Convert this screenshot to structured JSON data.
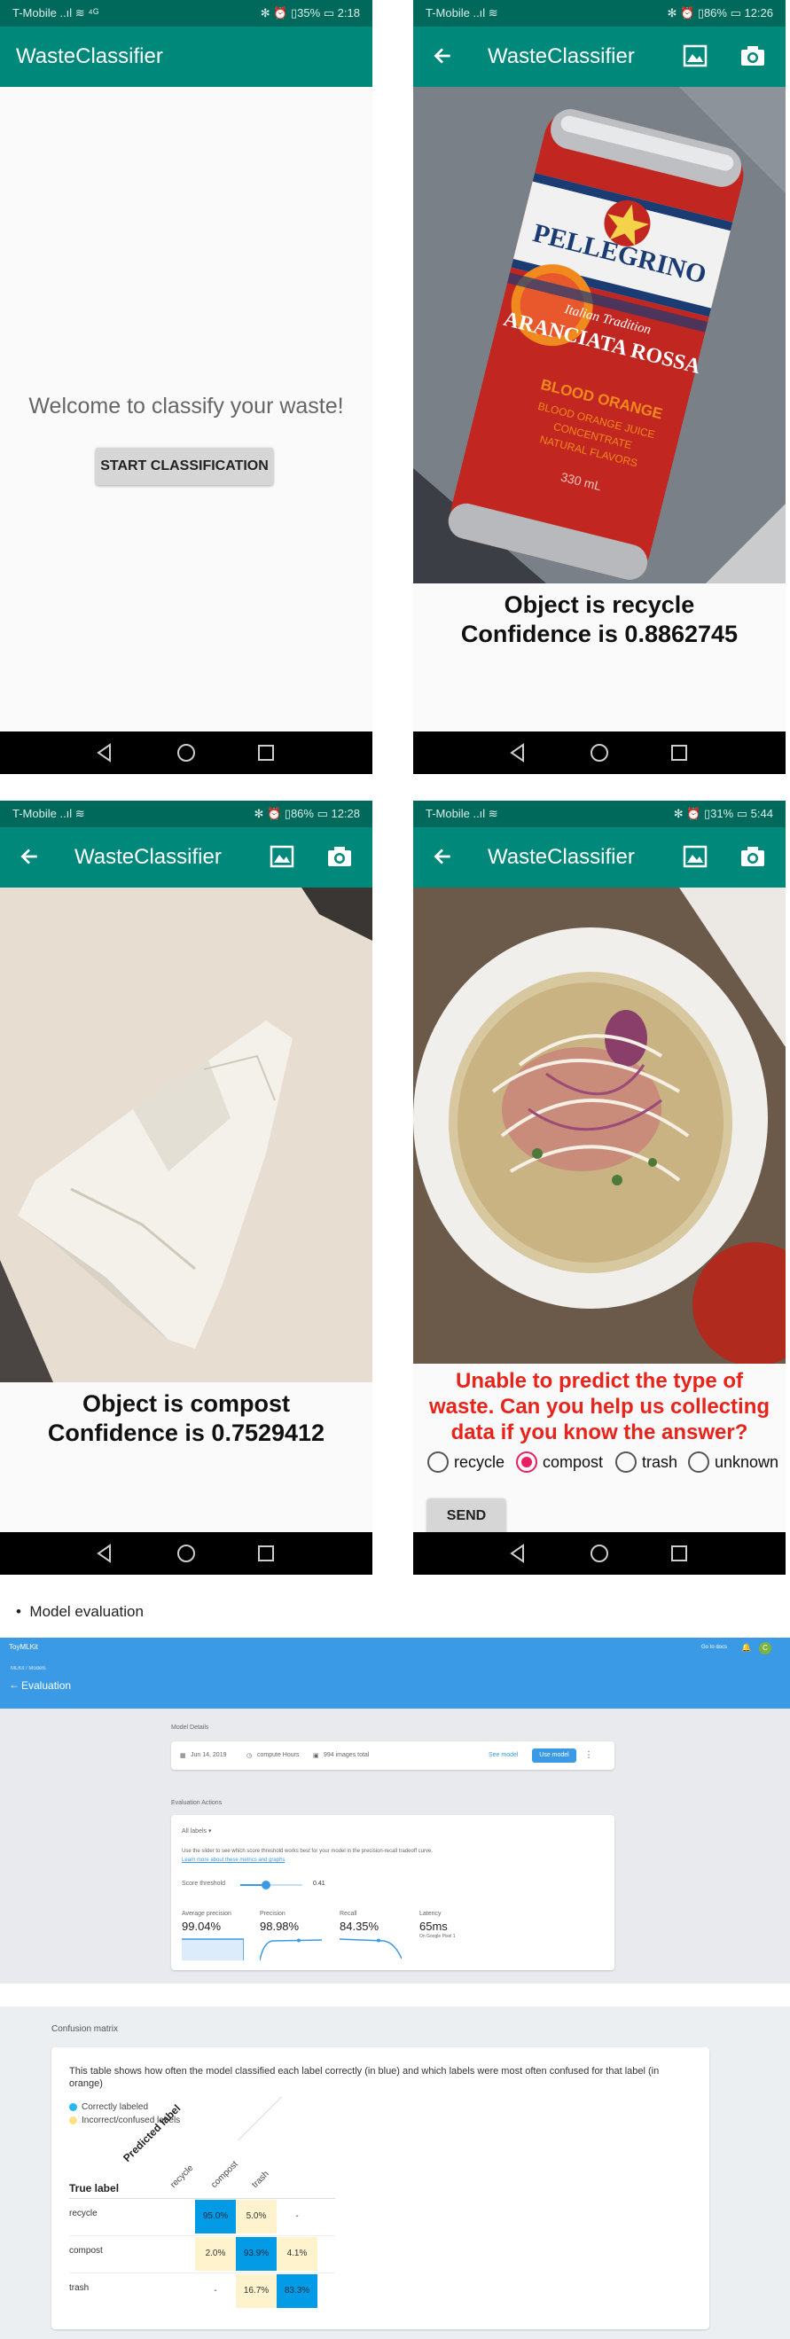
{
  "phone1": {
    "status_left": "T-Mobile ..ıl ≋ ⁴ᴳ",
    "status_right": "✻ ⏰ ▯35% ▭ 2:18",
    "app_title": "WasteClassifier",
    "welcome": "Welcome to classify your waste!",
    "start_button": "START CLASSIFICATION"
  },
  "phone2": {
    "status_left": "T-Mobile ..ıl ≋",
    "status_right": "✻ ⏰ ▯86% ▭ 12:26",
    "app_title": "WasteClassifier",
    "result_line1": "Object is recycle",
    "result_line2": "Confidence is 0.8862745",
    "can_texts": [
      "PELLEGRINO",
      "Italian Tradition",
      "ARANCIATA ROSSA",
      "BLOOD ORANGE",
      "BLOOD ORANGE JUICE",
      "CONCENTRATE",
      "NATURAL FLAVORS",
      "330 mL"
    ]
  },
  "phone3": {
    "status_left": "T-Mobile ..ıl ≋",
    "status_right": "✻ ⏰ ▯86% ▭ 12:28",
    "app_title": "WasteClassifier",
    "result_line1": "Object is compost",
    "result_line2": "Confidence is 0.7529412"
  },
  "phone4": {
    "status_left": "T-Mobile ..ıl ≋",
    "status_right": "✻ ⏰ ▯31% ▭ 5:44",
    "app_title": "WasteClassifier",
    "unable_text": "Unable to predict the type of waste. Can you help us collecting data if you know the answer?",
    "options": [
      {
        "label": "recycle",
        "selected": false
      },
      {
        "label": "compost",
        "selected": true
      },
      {
        "label": "trash",
        "selected": false
      },
      {
        "label": "unknown",
        "selected": false
      }
    ],
    "send_button": "SEND"
  },
  "section_bullet": "Model evaluation",
  "evaluation": {
    "brand": "ToyMLKit",
    "breadcrumb": "MLKit / Models",
    "page_title": "Evaluation",
    "top_right_link": "Go to docs",
    "avatar_letter": "C",
    "model_details_title": "Model Details",
    "model_date": "Jun 14, 2019",
    "model_name": "compute Hours",
    "model_images": "994 images total",
    "see_model": "See model",
    "use_model_button": "Use model",
    "eval_actions_title": "Evaluation Actions",
    "all_labels": "All labels",
    "slider_help": "Use the slider to see which score threshold works best for your model in the precision-recall tradeoff curve.",
    "learn_more": "Learn more about these metrics and graphs",
    "score_threshold_label": "Score threshold",
    "score_threshold_value": "0.41",
    "metrics": [
      {
        "label": "Average precision",
        "value": "99.04%"
      },
      {
        "label": "Precision",
        "value": "98.98%"
      },
      {
        "label": "Recall",
        "value": "84.35%"
      },
      {
        "label": "Latency",
        "value": "65ms",
        "sub": "On Google Pixel 1"
      }
    ],
    "accent": "#3a9ae6"
  },
  "confusion": {
    "title": "Confusion matrix",
    "description": "This table shows how often the model classified each label correctly (in blue) and which labels were most often confused for that label (in orange)",
    "legend_correct": "Correctly labeled",
    "legend_incorrect": "Incorrect/confused labels",
    "true_label_header": "True label",
    "predicted_label_header": "Predicted label",
    "columns": [
      "recycle",
      "compost",
      "trash"
    ],
    "rows": [
      {
        "label": "recycle",
        "cells": [
          "95.0%",
          "5.0%",
          "-"
        ]
      },
      {
        "label": "compost",
        "cells": [
          "2.0%",
          "93.9%",
          "4.1%"
        ]
      },
      {
        "label": "trash",
        "cells": [
          "-",
          "16.7%",
          "83.3%"
        ]
      }
    ],
    "correct_color": "#039be5",
    "confused_color": "#fff3cd"
  }
}
